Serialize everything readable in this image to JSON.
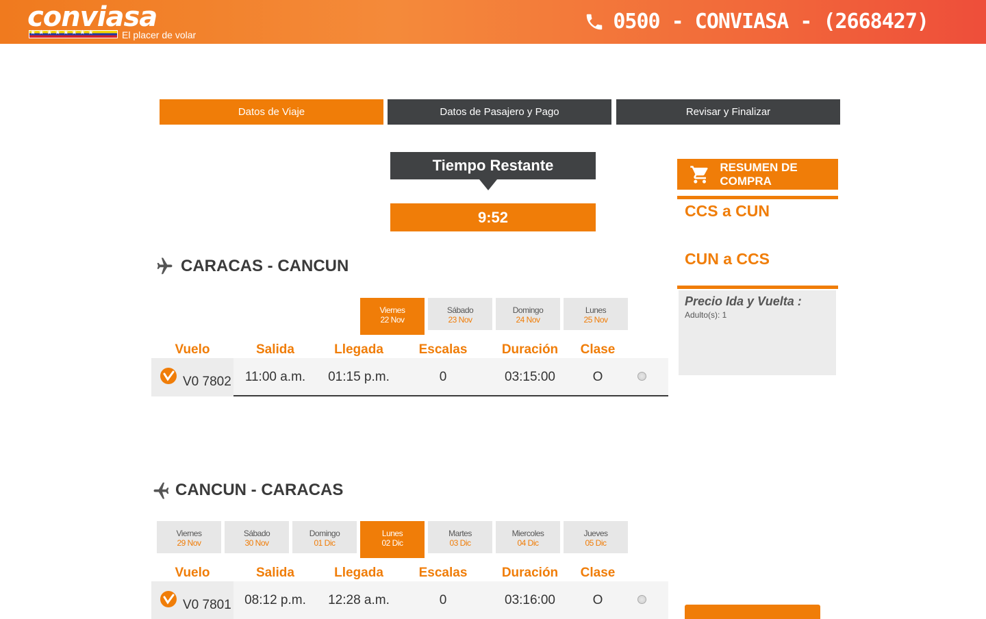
{
  "header": {
    "logo_text": "conviasa",
    "tagline": "El placer de volar",
    "phone": "0500 - CONVIASA - (2668427)"
  },
  "steps": [
    {
      "label": "Datos de Viaje",
      "active": true
    },
    {
      "label": "Datos de Pasajero y Pago",
      "active": false
    },
    {
      "label": "Revisar y Finalizar",
      "active": false
    }
  ],
  "timer": {
    "title": "Tiempo Restante",
    "value": "9:52"
  },
  "columns": [
    "Vuelo",
    "Salida",
    "Llegada",
    "Escalas",
    "Duración",
    "Clase"
  ],
  "outbound": {
    "title": "CARACAS - CANCUN",
    "dates": [
      {
        "day": "Viernes",
        "date": "22 Nov",
        "active": true
      },
      {
        "day": "Sábado",
        "date": "23 Nov",
        "active": false
      },
      {
        "day": "Domingo",
        "date": "24 Nov",
        "active": false
      },
      {
        "day": "Lunes",
        "date": "25 Nov",
        "active": false
      }
    ],
    "flight": {
      "number": "V0 7802",
      "departure": "11:00 a.m.",
      "arrival": "01:15 p.m.",
      "stops": "0",
      "duration": "03:15:00",
      "class": "O"
    }
  },
  "inbound": {
    "title": "CANCUN - CARACAS",
    "dates": [
      {
        "day": "Viernes",
        "date": "29 Nov",
        "active": false
      },
      {
        "day": "Sábado",
        "date": "30 Nov",
        "active": false
      },
      {
        "day": "Domingo",
        "date": "01 Dic",
        "active": false
      },
      {
        "day": "Lunes",
        "date": "02 Dic",
        "active": true
      },
      {
        "day": "Martes",
        "date": "03 Dic",
        "active": false
      },
      {
        "day": "Miercoles",
        "date": "04 Dic",
        "active": false
      },
      {
        "day": "Jueves",
        "date": "05 Dic",
        "active": false
      }
    ],
    "flight": {
      "number": "V0 7801",
      "departure": "08:12 p.m.",
      "arrival": "12:28 a.m.",
      "stops": "0",
      "duration": "03:16:00",
      "class": "O"
    }
  },
  "summary": {
    "title": "RESUMEN DE COMPRA",
    "route_out": "CCS a CUN",
    "route_in": "CUN a CCS",
    "price_title": "Precio Ida y Vuelta :",
    "passengers": "Adulto(s): 1"
  },
  "colors": {
    "brand_orange": "#f07d08",
    "dark_gray": "#404244",
    "header_red": "#ee4e3a"
  }
}
